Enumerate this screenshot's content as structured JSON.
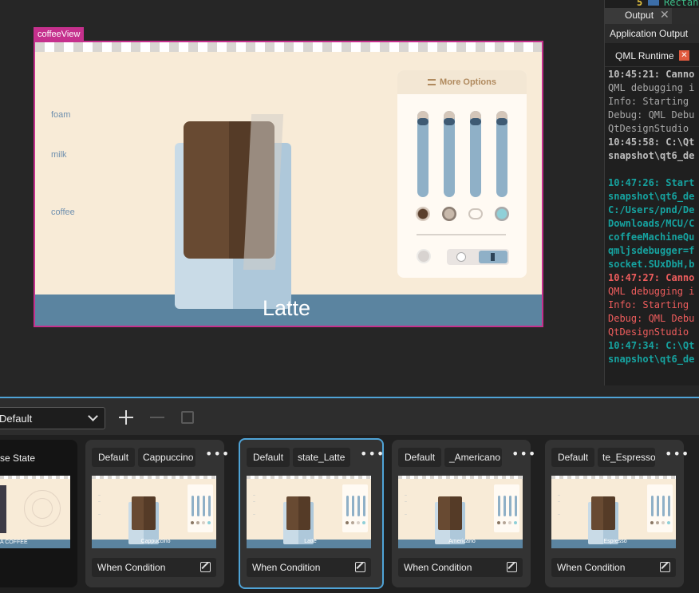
{
  "canvas": {
    "component_tag": "coffeeView",
    "cup_name": "Latte",
    "labels": {
      "foam": "foam",
      "milk": "milk",
      "coffee": "coffee"
    },
    "options_title": "More Options",
    "colors": {
      "accent": "#c5308d",
      "band": "#5b84a0",
      "background": "#f8ebd7"
    }
  },
  "output": {
    "top_line_number": "5",
    "top_line_text": "Rectan",
    "tab_label": "Output",
    "application_output": "Application Output",
    "runtime_tab": "QML Runtime",
    "log": [
      {
        "text": "10:45:21: Canno",
        "cls": "c-grayb"
      },
      {
        "text": "QML debugging i",
        "cls": "c-gray"
      },
      {
        "text": "Info: Starting",
        "cls": "c-gray"
      },
      {
        "text": "Debug: QML Debu",
        "cls": "c-gray"
      },
      {
        "text": "QtDesignStudio",
        "cls": "c-gray"
      },
      {
        "text": "10:45:58: C:\\Qt",
        "cls": "c-grayb"
      },
      {
        "text": "snapshot\\qt6_de",
        "cls": "c-grayb"
      },
      {
        "text": "",
        "cls": "c-gray"
      },
      {
        "text": "10:47:26: Start",
        "cls": "c-cyan"
      },
      {
        "text": "snapshot\\qt6_de",
        "cls": "c-cyan"
      },
      {
        "text": "C:/Users/pnd/De",
        "cls": "c-cyan"
      },
      {
        "text": "Downloads/MCU/C",
        "cls": "c-cyan"
      },
      {
        "text": "coffeeMachineQu",
        "cls": "c-cyan"
      },
      {
        "text": "qmljsdebugger=f",
        "cls": "c-cyan"
      },
      {
        "text": "socket.SUxDbH,b",
        "cls": "c-cyan"
      },
      {
        "text": "10:47:27: Canno",
        "cls": "c-redb"
      },
      {
        "text": "QML debugging i",
        "cls": "c-red"
      },
      {
        "text": "Info: Starting",
        "cls": "c-red"
      },
      {
        "text": "Debug: QML Debu",
        "cls": "c-red"
      },
      {
        "text": "QtDesignStudio",
        "cls": "c-red"
      },
      {
        "text": "10:47:34: C:\\Qt",
        "cls": "c-cyan"
      },
      {
        "text": "snapshot\\qt6_de",
        "cls": "c-cyan"
      }
    ]
  },
  "states": {
    "combo_value": "Default",
    "base_state_label": "se State",
    "base_thumb_text": "A COFFEE",
    "cards": [
      {
        "default_label": "Default",
        "state_name": "Cappuccino",
        "thumb_name": "Cappuccino",
        "condition": "When Condition",
        "selected": false
      },
      {
        "default_label": "Default",
        "state_name": "state_Latte",
        "thumb_name": "Latte",
        "condition": "When Condition",
        "selected": true
      },
      {
        "default_label": "Default",
        "state_name": "_Americano",
        "thumb_name": "Americano",
        "condition": "When Condition",
        "selected": false
      },
      {
        "default_label": "Default",
        "state_name": "te_Espresso",
        "thumb_name": "Espresso",
        "condition": "When Condition",
        "selected": false
      }
    ]
  }
}
